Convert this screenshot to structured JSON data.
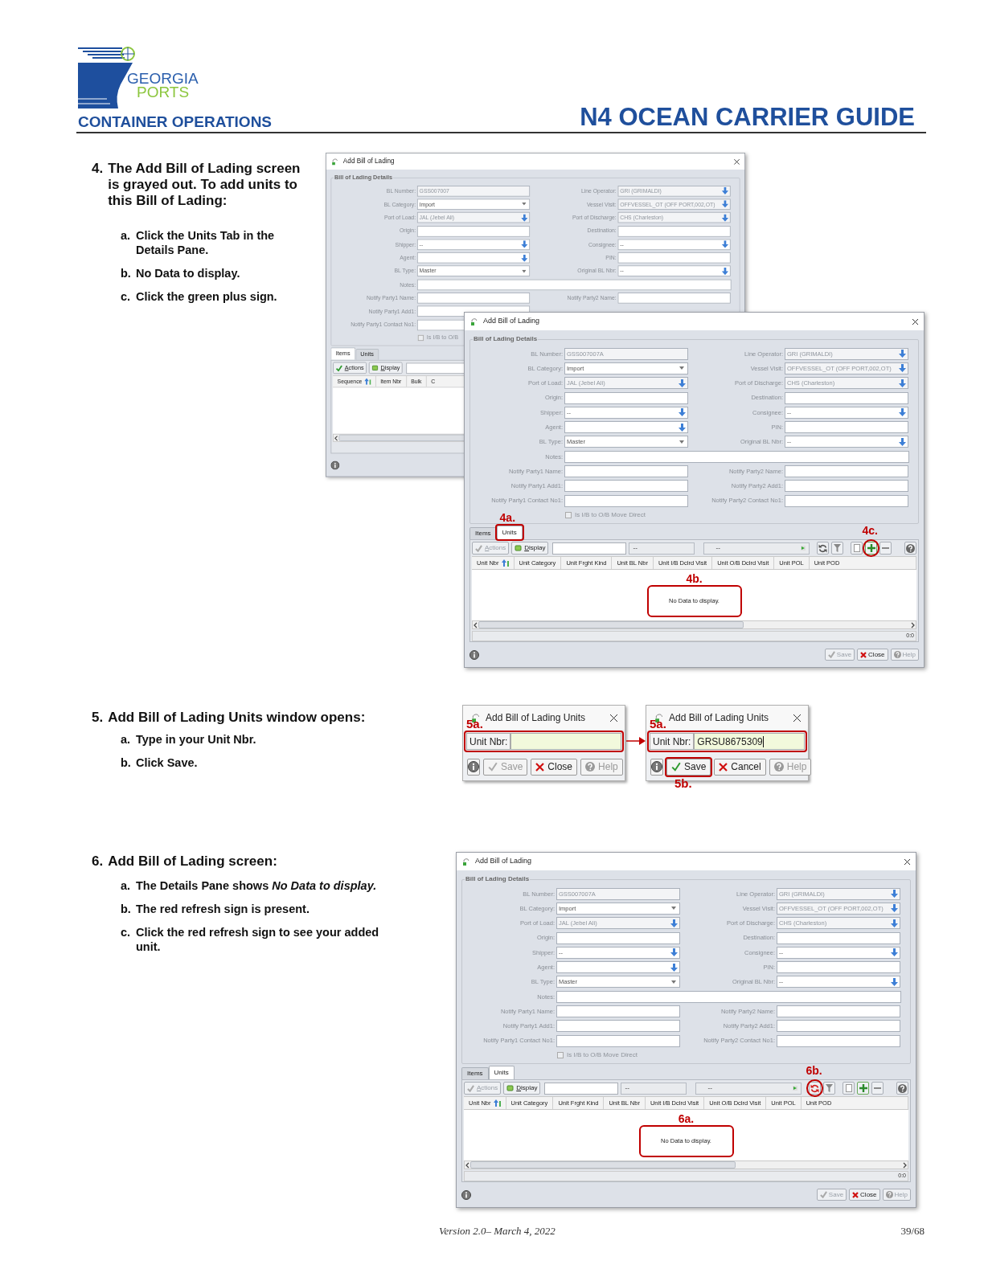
{
  "header": {
    "logo_line1": "GEORGIA",
    "logo_line2": "PORTS",
    "section": "CONTAINER OPERATIONS",
    "title": "N4 OCEAN CARRIER GUIDE"
  },
  "sections": [
    {
      "number": "4.",
      "heading": "The Add Bill of Lading screen is grayed out.  To add units to this Bill of Lading:",
      "substeps": [
        {
          "letter": "a.",
          "text": "Click the Units Tab in the Details Pane."
        },
        {
          "letter": "b.",
          "text": "No Data to display."
        },
        {
          "letter": "c.",
          "text": "Click the green plus sign."
        }
      ],
      "figure": {
        "kind": "bl_pair",
        "windows": [
          {
            "title": "Add Bill of Lading",
            "group": "Bill of Lading Details",
            "field_rows": [
              {
                "fields": [
                  {
                    "label": "BL Number:",
                    "value": "GSS007007",
                    "kind": "text",
                    "readonly": true
                  },
                  {
                    "label": "Line Operator:",
                    "value": "GRI (GRIMALDI)",
                    "kind": "lookup",
                    "readonly": true
                  }
                ]
              },
              {
                "fields": [
                  {
                    "label": "BL Category:",
                    "value": "Import",
                    "kind": "select",
                    "readonly": false
                  },
                  {
                    "label": "Vessel Visit:",
                    "value": "OFFVESSEL_OT (OFF PORT,002,OT)",
                    "kind": "lookup",
                    "readonly": true
                  }
                ]
              },
              {
                "fields": [
                  {
                    "label": "Port of Load:",
                    "value": "JAL (Jebel Ali)",
                    "kind": "lookup",
                    "readonly": true
                  },
                  {
                    "label": "Port of Discharge:",
                    "value": "CHS (Charleston)",
                    "kind": "lookup",
                    "readonly": true
                  }
                ]
              },
              {
                "fields": [
                  {
                    "label": "Origin:",
                    "kind": "text",
                    "readonly": false
                  },
                  {
                    "label": "Destination:",
                    "kind": "text",
                    "readonly": false
                  }
                ]
              },
              {
                "fields": [
                  {
                    "label": "Shipper:",
                    "value": "--",
                    "kind": "lookup",
                    "readonly": false
                  },
                  {
                    "label": "Consignee:",
                    "value": "--",
                    "kind": "lookup",
                    "readonly": false
                  }
                ]
              },
              {
                "fields": [
                  {
                    "label": "Agent:",
                    "kind": "lookup",
                    "readonly": false
                  },
                  {
                    "label": "PIN:",
                    "kind": "text",
                    "readonly": false
                  }
                ]
              },
              {
                "fields": [
                  {
                    "label": "BL Type:",
                    "value": "Master",
                    "kind": "select",
                    "readonly": false
                  },
                  {
                    "label": "Original BL Nbr:",
                    "value": "--",
                    "kind": "lookup",
                    "readonly": false
                  }
                ]
              },
              {
                "fields": [
                  {
                    "label": "Notes:",
                    "kind": "note",
                    "readonly": false
                  }
                ]
              },
              {
                "fields": [
                  {
                    "label": "Notify Party1 Name:",
                    "kind": "text",
                    "readonly": false
                  },
                  {
                    "label": "Notify Party2 Name:",
                    "kind": "text",
                    "readonly": false
                  }
                ]
              },
              {
                "fields": [
                  {
                    "label": "Notify Party1 Add1:",
                    "kind": "text",
                    "readonly": false
                  }
                ]
              },
              {
                "fields": [
                  {
                    "label": "Notify Party1 Contact No1:",
                    "kind": "text",
                    "readonly": false
                  }
                ]
              }
            ],
            "checkbox": {
              "label": "Is I/B to O/B",
              "checked": false
            },
            "tabs": [
              {
                "label": "Items",
                "selected": true
              },
              {
                "label": "Units",
                "selected": false
              }
            ],
            "toolbar": {
              "buttons": [
                {
                  "label": "Actions",
                  "kind": "actions",
                  "disabled": false
                },
                {
                  "label": "Display",
                  "kind": "display",
                  "disabled": false
                }
              ]
            },
            "columns": [
              "Sequence",
              "Item Nbr",
              "Bulk",
              "C"
            ]
          },
          {
            "title": "Add Bill of Lading",
            "group": "Bill of Lading Details",
            "field_rows": [
              {
                "fields": [
                  {
                    "label": "BL Number:",
                    "value": "GSS007007A",
                    "kind": "text",
                    "readonly": true
                  },
                  {
                    "label": "Line Operator:",
                    "value": "GRI (GRIMALDI)",
                    "kind": "lookup",
                    "readonly": true
                  }
                ]
              },
              {
                "fields": [
                  {
                    "label": "BL Category:",
                    "value": "Import",
                    "kind": "select",
                    "readonly": false
                  },
                  {
                    "label": "Vessel Visit:",
                    "value": "OFFVESSEL_OT (OFF PORT,002,OT)",
                    "kind": "lookup",
                    "readonly": true
                  }
                ]
              },
              {
                "fields": [
                  {
                    "label": "Port of Load:",
                    "value": "JAL (Jebel Ali)",
                    "kind": "lookup",
                    "readonly": true
                  },
                  {
                    "label": "Port of Discharge:",
                    "value": "CHS (Charleston)",
                    "kind": "lookup",
                    "readonly": true
                  }
                ]
              },
              {
                "fields": [
                  {
                    "label": "Origin:",
                    "kind": "text",
                    "readonly": false
                  },
                  {
                    "label": "Destination:",
                    "kind": "text",
                    "readonly": false
                  }
                ]
              },
              {
                "fields": [
                  {
                    "label": "Shipper:",
                    "value": "--",
                    "kind": "lookup",
                    "readonly": false
                  },
                  {
                    "label": "Consignee:",
                    "value": "--",
                    "kind": "lookup",
                    "readonly": false
                  }
                ]
              },
              {
                "fields": [
                  {
                    "label": "Agent:",
                    "kind": "lookup",
                    "readonly": false
                  },
                  {
                    "label": "PIN:",
                    "kind": "text",
                    "readonly": false
                  }
                ]
              },
              {
                "fields": [
                  {
                    "label": "BL Type:",
                    "value": "Master",
                    "kind": "select",
                    "readonly": false
                  },
                  {
                    "label": "Original BL Nbr:",
                    "value": "--",
                    "kind": "lookup",
                    "readonly": false
                  }
                ]
              },
              {
                "fields": [
                  {
                    "label": "Notes:",
                    "kind": "note",
                    "readonly": false
                  }
                ]
              },
              {
                "fields": [
                  {
                    "label": "Notify Party1 Name:",
                    "kind": "text",
                    "readonly": false
                  },
                  {
                    "label": "Notify Party2 Name:",
                    "kind": "text",
                    "readonly": false
                  }
                ]
              },
              {
                "fields": [
                  {
                    "label": "Notify Party1 Add1:",
                    "kind": "text",
                    "readonly": false
                  },
                  {
                    "label": "Notify Party2 Add1:",
                    "kind": "text",
                    "readonly": false
                  }
                ]
              },
              {
                "fields": [
                  {
                    "label": "Notify Party1 Contact No1:",
                    "kind": "text",
                    "readonly": false
                  },
                  {
                    "label": "Notify Party2 Contact No1:",
                    "kind": "text",
                    "readonly": false
                  }
                ]
              }
            ],
            "checkbox": {
              "label": "Is I/B to O/B Move Direct",
              "checked": false
            },
            "tabs": [
              {
                "label": "Items",
                "selected": false
              },
              {
                "label": "Units",
                "selected": true
              }
            ],
            "toolbar": {
              "buttons": [
                {
                  "label": "Actions",
                  "kind": "actions",
                  "disabled": true
                },
                {
                  "label": "Display",
                  "kind": "display",
                  "disabled": false
                }
              ],
              "selects": [
                "--",
                "--"
              ],
              "tools": {
                "refresh_alert": false
              }
            },
            "columns": [
              "Unit Nbr",
              "Unit Category",
              "Unit Frght Kind",
              "Unit BL Nbr",
              "Unit I/B Dclrd Visit",
              "Unit O/B Dclrd Visit",
              "Unit POL",
              "Unit POD"
            ],
            "empty_message": "No Data to display.",
            "status": "0:0",
            "footer_buttons": [
              {
                "label": "Save",
                "kind": "save",
                "disabled": true
              },
              {
                "label": "Close",
                "kind": "close",
                "disabled": false
              },
              {
                "label": "Help",
                "kind": "help",
                "disabled": true
              }
            ],
            "callouts": [
              {
                "label": "4a.",
                "kind": "selected_tab"
              },
              {
                "label": "4b.",
                "kind": "empty_message"
              },
              {
                "label": "4c.",
                "kind": "add_button"
              }
            ]
          }
        ]
      }
    },
    {
      "number": "5.",
      "heading": "Add Bill of Lading Units window opens:",
      "substeps": [
        {
          "letter": "a.",
          "text": "Type in your Unit Nbr."
        },
        {
          "letter": "b.",
          "text": "Click Save."
        }
      ],
      "figure": {
        "kind": "unit_dialogs",
        "dialogs": [
          {
            "title": "Add Bill of Lading Units",
            "field_label": "Unit Nbr:",
            "focused": false,
            "buttons": [
              {
                "label": "Save",
                "kind": "save",
                "disabled": true
              },
              {
                "label": "Close",
                "kind": "close",
                "disabled": false
              },
              {
                "label": "Help",
                "kind": "help",
                "disabled": true
              }
            ],
            "callouts": [
              {
                "label": "5a.",
                "kind": "unit_field"
              }
            ]
          },
          {
            "title": "Add Bill of Lading Units",
            "field_label": "Unit Nbr:",
            "value": "GRSU8675309",
            "focused": true,
            "buttons": [
              {
                "label": "Save",
                "kind": "save",
                "disabled": false
              },
              {
                "label": "Cancel",
                "kind": "cancel",
                "disabled": false
              },
              {
                "label": "Help",
                "kind": "help",
                "disabled": true
              }
            ],
            "callouts": [
              {
                "label": "5a.",
                "kind": "unit_field"
              },
              {
                "label": "5b.",
                "kind": "save_button"
              }
            ]
          }
        ]
      }
    },
    {
      "number": "6.",
      "heading": "Add Bill of Lading screen:",
      "substeps": [
        {
          "letter": "a.",
          "text": "The Details Pane shows *No Data to display.*"
        },
        {
          "letter": "b.",
          "text": "The red refresh sign is present."
        },
        {
          "letter": "c.",
          "text": "Click the red refresh sign to see your added unit."
        }
      ],
      "figure": {
        "kind": "bl_single",
        "windows": [
          {
            "title": "Add Bill of Lading",
            "group": "Bill of Lading Details",
            "field_rows": [
              {
                "fields": [
                  {
                    "label": "BL Number:",
                    "value": "GSS007007A",
                    "kind": "text",
                    "readonly": true
                  },
                  {
                    "label": "Line Operator:",
                    "value": "GRI (GRIMALDI)",
                    "kind": "lookup",
                    "readonly": true
                  }
                ]
              },
              {
                "fields": [
                  {
                    "label": "BL Category:",
                    "value": "Import",
                    "kind": "select",
                    "readonly": false
                  },
                  {
                    "label": "Vessel Visit:",
                    "value": "OFFVESSEL_OT (OFF PORT,002,OT)",
                    "kind": "lookup",
                    "readonly": true
                  }
                ]
              },
              {
                "fields": [
                  {
                    "label": "Port of Load:",
                    "value": "JAL (Jebel Ali)",
                    "kind": "lookup",
                    "readonly": true
                  },
                  {
                    "label": "Port of Discharge:",
                    "value": "CHS (Charleston)",
                    "kind": "lookup",
                    "readonly": true
                  }
                ]
              },
              {
                "fields": [
                  {
                    "label": "Origin:",
                    "kind": "text",
                    "readonly": false
                  },
                  {
                    "label": "Destination:",
                    "kind": "text",
                    "readonly": false
                  }
                ]
              },
              {
                "fields": [
                  {
                    "label": "Shipper:",
                    "value": "--",
                    "kind": "lookup",
                    "readonly": false
                  },
                  {
                    "label": "Consignee:",
                    "value": "--",
                    "kind": "lookup",
                    "readonly": false
                  }
                ]
              },
              {
                "fields": [
                  {
                    "label": "Agent:",
                    "kind": "lookup",
                    "readonly": false
                  },
                  {
                    "label": "PIN:",
                    "kind": "text",
                    "readonly": false
                  }
                ]
              },
              {
                "fields": [
                  {
                    "label": "BL Type:",
                    "value": "Master",
                    "kind": "select",
                    "readonly": false
                  },
                  {
                    "label": "Original BL Nbr:",
                    "value": "--",
                    "kind": "lookup",
                    "readonly": false
                  }
                ]
              },
              {
                "fields": [
                  {
                    "label": "Notes:",
                    "kind": "note",
                    "readonly": false
                  }
                ]
              },
              {
                "fields": [
                  {
                    "label": "Notify Party1 Name:",
                    "kind": "text",
                    "readonly": false
                  },
                  {
                    "label": "Notify Party2 Name:",
                    "kind": "text",
                    "readonly": false
                  }
                ]
              },
              {
                "fields": [
                  {
                    "label": "Notify Party1 Add1:",
                    "kind": "text",
                    "readonly": false
                  },
                  {
                    "label": "Notify Party2 Add1:",
                    "kind": "text",
                    "readonly": false
                  }
                ]
              },
              {
                "fields": [
                  {
                    "label": "Notify Party1 Contact No1:",
                    "kind": "text",
                    "readonly": false
                  },
                  {
                    "label": "Notify Party2 Contact No1:",
                    "kind": "text",
                    "readonly": false
                  }
                ]
              }
            ],
            "checkbox": {
              "label": "Is I/B to O/B Move Direct",
              "checked": false
            },
            "tabs": [
              {
                "label": "Items",
                "selected": false
              },
              {
                "label": "Units",
                "selected": true
              }
            ],
            "toolbar": {
              "buttons": [
                {
                  "label": "Actions",
                  "kind": "actions",
                  "disabled": true
                },
                {
                  "label": "Display",
                  "kind": "display",
                  "disabled": false
                }
              ],
              "selects": [
                "--",
                "--"
              ],
              "tools": {
                "refresh_alert": true
              }
            },
            "columns": [
              "Unit Nbr",
              "Unit Category",
              "Unit Frght Kind",
              "Unit BL Nbr",
              "Unit I/B Dclrd Visit",
              "Unit O/B Dclrd Visit",
              "Unit POL",
              "Unit POD"
            ],
            "empty_message": "No Data to display.",
            "status": "0:0",
            "footer_buttons": [
              {
                "label": "Save",
                "kind": "save",
                "disabled": true
              },
              {
                "label": "Close",
                "kind": "close",
                "disabled": false
              },
              {
                "label": "Help",
                "kind": "help",
                "disabled": true
              }
            ],
            "callouts": [
              {
                "label": "6a.",
                "kind": "empty_message"
              },
              {
                "label": "6b.",
                "kind": "refresh_button"
              }
            ]
          }
        ]
      }
    }
  ],
  "footer": {
    "version": "Version 2.0– March 4, 2022",
    "page": "39/68"
  }
}
